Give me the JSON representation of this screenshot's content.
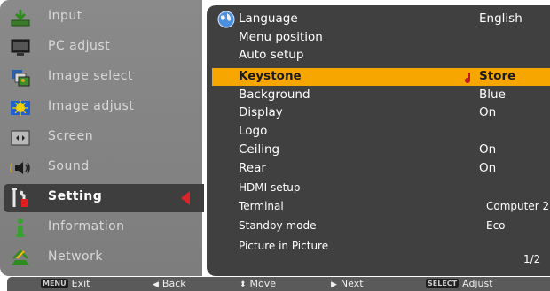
{
  "left_menu": {
    "items": [
      {
        "label": "Input",
        "icon": "input-icon"
      },
      {
        "label": "PC adjust",
        "icon": "pc-adjust-icon"
      },
      {
        "label": "Image select",
        "icon": "image-select-icon"
      },
      {
        "label": "Image adjust",
        "icon": "image-adjust-icon"
      },
      {
        "label": "Screen",
        "icon": "screen-icon"
      },
      {
        "label": "Sound",
        "icon": "sound-icon"
      },
      {
        "label": "Setting",
        "icon": "setting-icon"
      },
      {
        "label": "Information",
        "icon": "information-icon"
      },
      {
        "label": "Network",
        "icon": "network-icon"
      }
    ],
    "active": "Setting"
  },
  "settings": {
    "rows": [
      {
        "label": "Language",
        "value": "English"
      },
      {
        "label": "Menu position",
        "value": ""
      },
      {
        "label": "Auto setup",
        "value": ""
      },
      {
        "label": "Keystone",
        "value": "Store"
      },
      {
        "label": "Background",
        "value": "Blue"
      },
      {
        "label": "Display",
        "value": "On"
      },
      {
        "label": "Logo",
        "value": ""
      },
      {
        "label": "Ceiling",
        "value": "On"
      },
      {
        "label": "Rear",
        "value": "On"
      },
      {
        "label": "HDMI setup",
        "value": ""
      },
      {
        "label": "Terminal",
        "value": "Computer 2"
      },
      {
        "label": "Standby mode",
        "value": "Eco"
      },
      {
        "label": "Picture in Picture",
        "value": ""
      }
    ],
    "highlighted": "Keystone",
    "page_indicator": "1/2"
  },
  "bottom_bar": {
    "menu_key": "MENU",
    "exit": "Exit",
    "back": "Back",
    "move": "Move",
    "next": "Next",
    "select_key": "SELECT",
    "adjust": "Adjust"
  },
  "colors": {
    "highlight": "#f7a600",
    "active_arrow": "#e0222a",
    "panel": "#404040",
    "left_panel": "#858585"
  }
}
